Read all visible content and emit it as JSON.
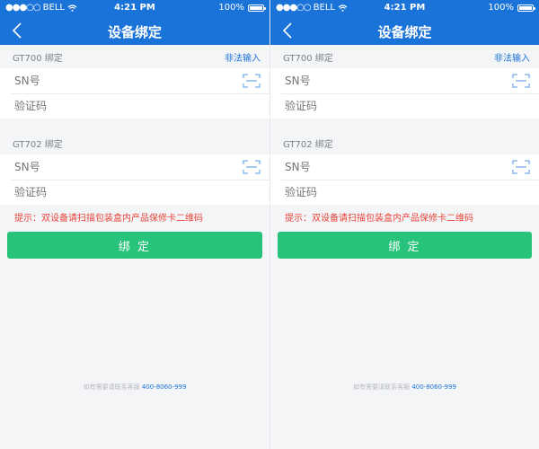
{
  "status": {
    "carrier": "BELL",
    "time": "4:21 PM",
    "battery": "100%",
    "battery_level": 1.0
  },
  "nav": {
    "title": "设备绑定"
  },
  "gt700": {
    "label": "GT700 绑定",
    "link": "非法输入",
    "sn_placeholder": "SN号",
    "code_placeholder": "验证码"
  },
  "gt702": {
    "label": "GT702 绑定",
    "sn_placeholder": "SN号",
    "code_placeholder": "验证码"
  },
  "tip": "提示：双设备请扫描包装盒内产品保修卡二维码",
  "bind_button": "绑 定",
  "footer": {
    "text": "如有需要请联系客服",
    "phone": "400-8060-999"
  },
  "colors": {
    "primary": "#1a73d9",
    "success": "#27c37a",
    "warning": "#e8433a"
  },
  "icons": [
    "signal-dots-icon",
    "wifi-icon",
    "battery-icon",
    "back-arrow-icon",
    "scan-icon"
  ]
}
